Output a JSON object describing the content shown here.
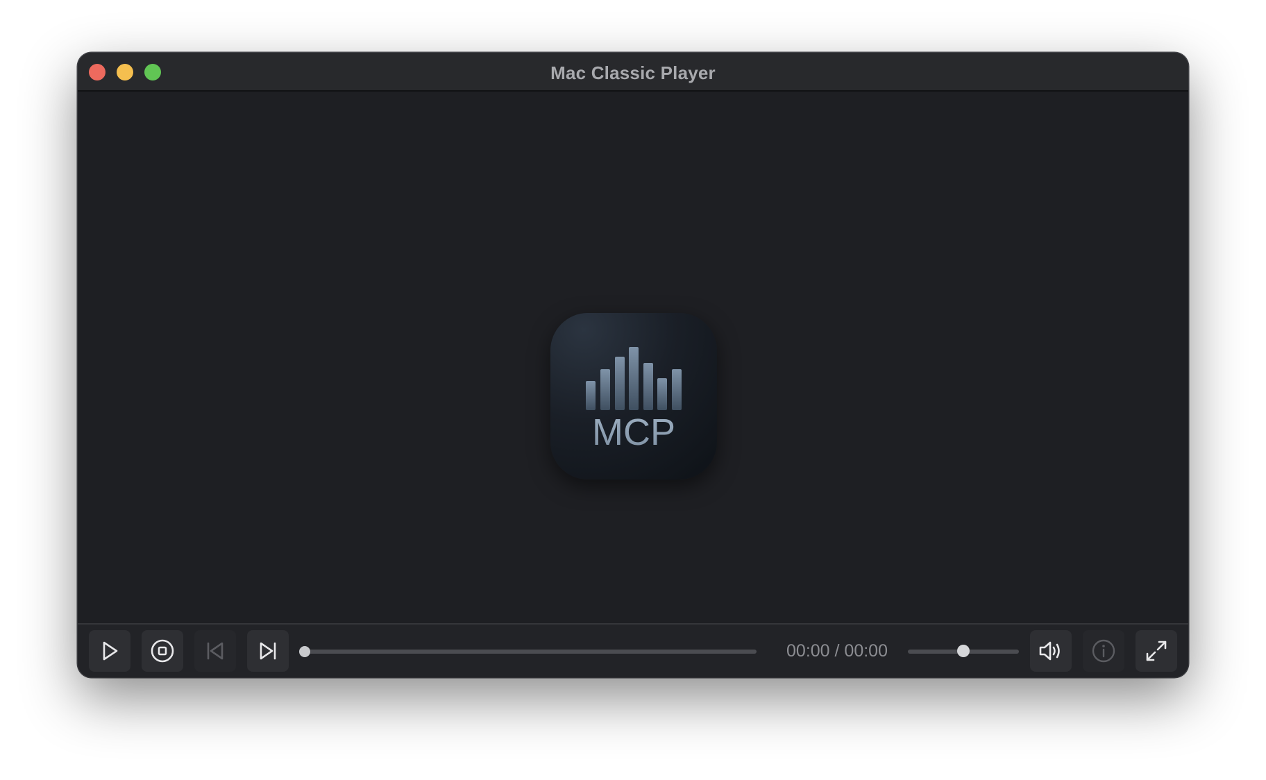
{
  "window": {
    "title": "Mac Classic Player",
    "traffic_lights": [
      {
        "name": "close",
        "color": "#ed6a5e"
      },
      {
        "name": "minimize",
        "color": "#f5bf4f"
      },
      {
        "name": "zoom",
        "color": "#61c554"
      }
    ]
  },
  "artwork": {
    "label": "MCP",
    "icon": "equalizer-bars-icon"
  },
  "controls": {
    "buttons": [
      {
        "id": "play",
        "icon": "play-icon",
        "enabled": true
      },
      {
        "id": "stop",
        "icon": "stop-circle-icon",
        "enabled": true
      },
      {
        "id": "previous",
        "icon": "skip-back-icon",
        "enabled": false
      },
      {
        "id": "next",
        "icon": "skip-forward-icon",
        "enabled": true
      },
      {
        "id": "volume",
        "icon": "speaker-volume-icon",
        "enabled": true
      },
      {
        "id": "info",
        "icon": "info-icon",
        "enabled": false
      },
      {
        "id": "fullscreen",
        "icon": "expand-icon",
        "enabled": true
      }
    ],
    "progress": 0.0,
    "time_display": "00:00 / 00:00",
    "volume": 0.5
  },
  "colors": {
    "background": "#1e1f23",
    "titlebar": "#28292c",
    "controlbar": "#222327",
    "accent_knob": "#c9cacd"
  }
}
